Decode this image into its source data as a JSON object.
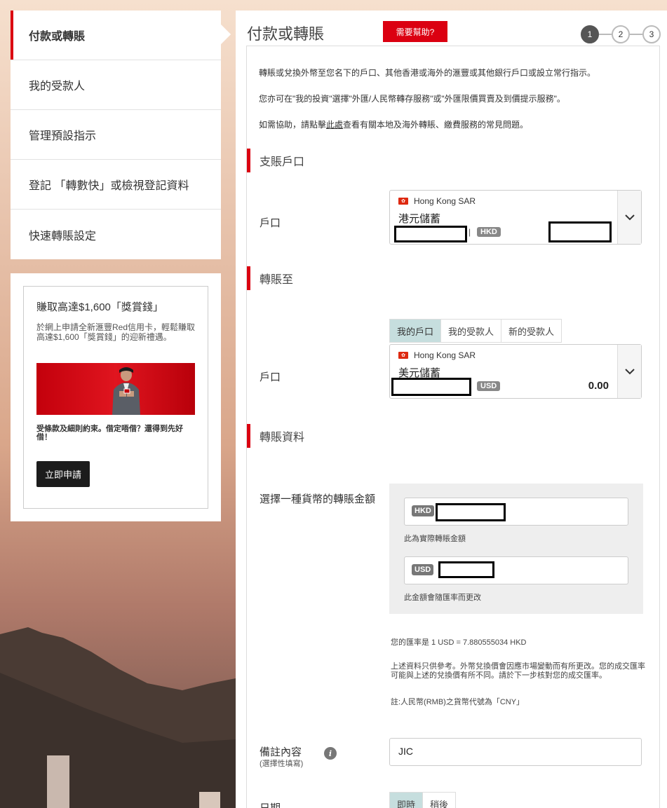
{
  "nav": {
    "items": [
      {
        "label": "付款或轉賬"
      },
      {
        "label": "我的受款人"
      },
      {
        "label": "管理預設指示"
      },
      {
        "label": "登記 「轉數快」或檢視登記資料"
      },
      {
        "label": "快速轉賬設定"
      }
    ]
  },
  "promo": {
    "title": "賺取高達$1,600「獎賞錢」",
    "description": "於網上申請全新滙豐Red信用卡，輕鬆賺取高達$1,600「獎賞錢」的迎新禮遇。",
    "note": "受條款及細則約束。借定唔借？還得到先好借！",
    "button": "立即申請"
  },
  "header": {
    "title": "付款或轉賬",
    "help_button": "需要幫助?",
    "steps": [
      "1",
      "2",
      "3"
    ]
  },
  "intro": {
    "line1": "轉賬或兌換外幣至您名下的戶口、其他香港或海外的滙豐或其他銀行戶口或設立常行指示。",
    "line2": "您亦可在\"我的投資\"選擇\"外匯/人民幣轉存服務\"或\"外匯限價買賣及到價提示服務\"。",
    "line3_pre": "如需協助，請點擊",
    "line3_link": "此處",
    "line3_post": "查看有關本地及海外轉賬、繳費服務的常見問題。"
  },
  "from_section": {
    "heading": "支賬戶口",
    "label": "戶口",
    "region": "Hong Kong SAR",
    "account_name": "港元儲蓄",
    "currency": "HKD"
  },
  "to_section": {
    "heading": "轉賬至",
    "tabs": [
      "我的戶口",
      "我的受款人",
      "新的受款人"
    ],
    "label": "戶口",
    "region": "Hong Kong SAR",
    "account_name": "美元儲蓄",
    "currency": "USD",
    "balance": "0.00"
  },
  "transfer_section": {
    "heading": "轉賬資料",
    "amount_label": "選擇一種貨幣的轉賬金額",
    "hkd_badge": "HKD",
    "hkd_note": "此為實際轉賬金額",
    "usd_badge": "USD",
    "usd_note": "此金額會隨匯率而更改",
    "rate": "您的匯率是 1 USD = 7.880555034 HKD",
    "disclaimer": "上述資料只供參考。外幣兌換價會因應市場變動而有所更改。您的成交匯率可能與上述的兌換價有所不同。請於下一步核對您的成交匯率。",
    "rmb_note": "註:人民幣(RMB)之貨幣代號為「CNY」",
    "remark_label": "備註內容",
    "remark_optional": "(選擇性填寫)",
    "remark_value": "JIC",
    "date_label": "日期",
    "date_options": [
      "即時",
      "稍後"
    ]
  },
  "colors": {
    "brand_red": "#db0011",
    "tab_active": "#c6dede"
  }
}
